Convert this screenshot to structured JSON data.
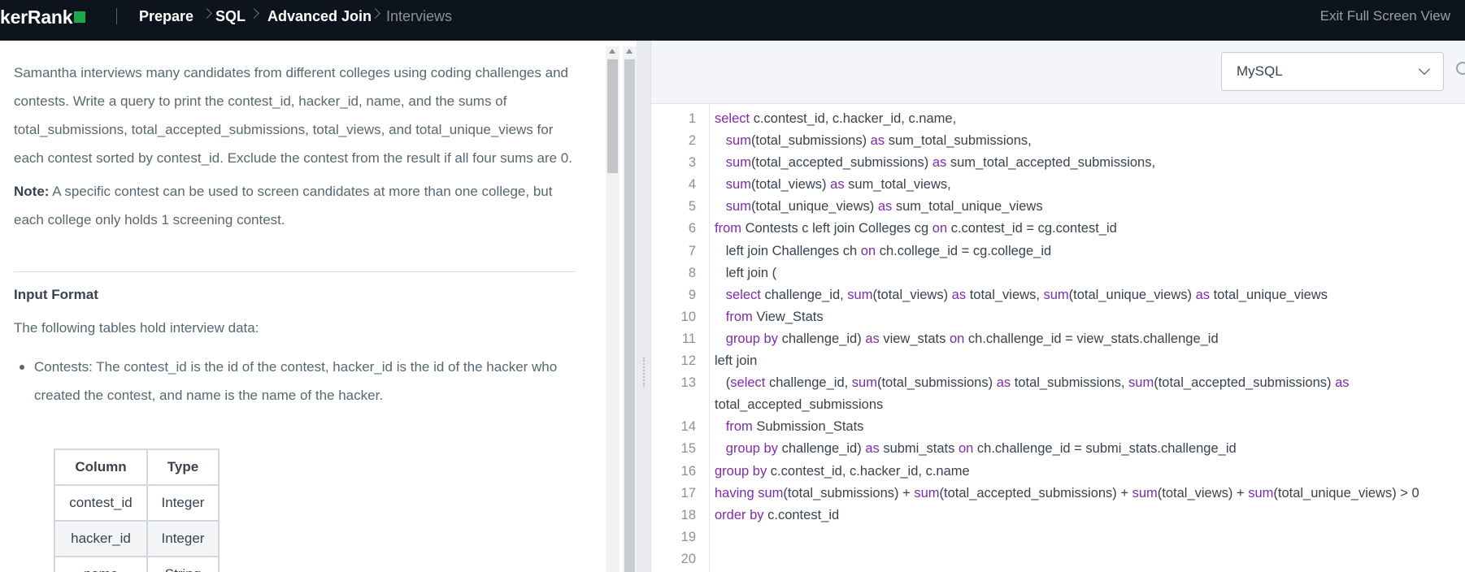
{
  "header": {
    "logo": "kerRank",
    "breadcrumbs": [
      "Prepare",
      "SQL",
      "Advanced Join",
      "Interviews"
    ],
    "exit_full_screen": "Exit Full Screen View"
  },
  "problem": {
    "description": "Samantha interviews many candidates from different colleges using coding challenges and contests. Write a query to print the contest_id, hacker_id, name, and the sums of total_submissions, total_accepted_submissions, total_views, and total_unique_views for each contest sorted by contest_id. Exclude the contest from the result if all four sums are 0.",
    "note_label": "Note:",
    "note_text": " A specific contest can be used to screen candidates at more than one college, but each college only holds 1 screening contest.",
    "input_format_title": "Input Format",
    "tables_intro": "The following tables hold interview data:",
    "bullet": "Contests: The contest_id is the id of the contest, hacker_id is the id of the hacker who created the contest, and name is the name of the hacker.",
    "schema_table": {
      "headers": [
        "Column",
        "Type"
      ],
      "rows": [
        [
          "contest_id",
          "Integer"
        ],
        [
          "hacker_id",
          "Integer"
        ],
        [
          "name",
          "String"
        ]
      ]
    }
  },
  "editor": {
    "language": "MySQL",
    "line_numbers": [
      "1",
      "2",
      "3",
      "4",
      "5",
      "6",
      "7",
      "8",
      "9",
      "10",
      "11",
      "12",
      "13",
      "14",
      "15",
      "16",
      "17",
      "18",
      "19",
      "20"
    ],
    "code_lines": [
      "select c.contest_id, c.hacker_id, c.name,",
      "   sum(total_submissions) as sum_total_submissions,",
      "   sum(total_accepted_submissions) as sum_total_accepted_submissions,",
      "   sum(total_views) as sum_total_views,",
      "   sum(total_unique_views) as sum_total_unique_views",
      "from Contests c left join Colleges cg on c.contest_id = cg.contest_id",
      "   left join Challenges ch on ch.college_id = cg.college_id",
      "   left join (",
      "   select challenge_id, sum(total_views) as total_views, sum(total_unique_views) as total_unique_views",
      "   from View_Stats",
      "   group by challenge_id) as view_stats on ch.challenge_id = view_stats.challenge_id",
      "left join",
      "   (select challenge_id, sum(total_submissions) as total_submissions, sum(total_accepted_submissions) as total_accepted_submissions",
      "   from Submission_Stats",
      "   group by challenge_id) as submi_stats on ch.challenge_id = submi_stats.challenge_id",
      "group by c.contest_id, c.hacker_id, c.name",
      "having sum(total_submissions) + sum(total_accepted_submissions) + sum(total_views) + sum(total_unique_views) > 0",
      "order by c.contest_id",
      "",
      ""
    ]
  }
}
